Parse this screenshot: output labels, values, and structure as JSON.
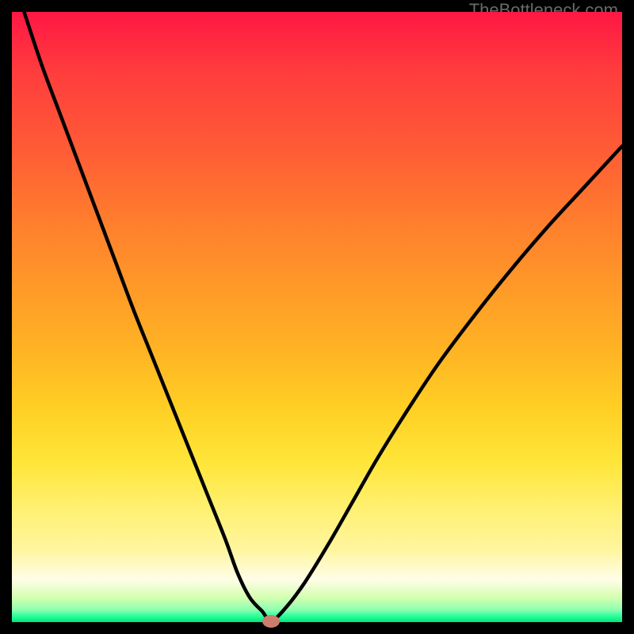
{
  "watermark": "TheBottleneck.com",
  "chart_data": {
    "type": "line",
    "title": "",
    "xlabel": "",
    "ylabel": "",
    "xlim": [
      0,
      100
    ],
    "ylim": [
      0,
      100
    ],
    "x": [
      2,
      5,
      8,
      11,
      14,
      17,
      20,
      23,
      26,
      29,
      32,
      35,
      37,
      39,
      41,
      42.5,
      45,
      48,
      52,
      56,
      60,
      65,
      70,
      76,
      82,
      88,
      94,
      100
    ],
    "y": [
      100,
      91,
      83,
      75,
      67,
      59,
      51,
      43.5,
      36,
      28.5,
      21,
      13.5,
      8,
      4,
      1.8,
      0.2,
      2.5,
      6.5,
      13,
      20,
      27,
      35,
      42.5,
      50.5,
      58,
      65,
      71.5,
      78
    ],
    "marker": {
      "x": 42.5,
      "y": 0.2
    },
    "gradient_stops": [
      {
        "pos": 0,
        "color": "#ff1744"
      },
      {
        "pos": 10,
        "color": "#ff3d3d"
      },
      {
        "pos": 22,
        "color": "#ff5a36"
      },
      {
        "pos": 33,
        "color": "#ff7a2e"
      },
      {
        "pos": 45,
        "color": "#ff9928"
      },
      {
        "pos": 55,
        "color": "#ffb224"
      },
      {
        "pos": 65,
        "color": "#ffcf24"
      },
      {
        "pos": 74,
        "color": "#ffe63a"
      },
      {
        "pos": 82,
        "color": "#fff176"
      },
      {
        "pos": 88,
        "color": "#fff59d"
      },
      {
        "pos": 93,
        "color": "#fffde7"
      },
      {
        "pos": 96,
        "color": "#d4ffb0"
      },
      {
        "pos": 98,
        "color": "#8cffb0"
      },
      {
        "pos": 99,
        "color": "#2bff9e"
      },
      {
        "pos": 100,
        "color": "#00e676"
      }
    ]
  },
  "colors": {
    "frame": "#000000",
    "curve": "#000000",
    "marker": "#cd7d6d",
    "watermark": "#6a6a6a"
  },
  "plot": {
    "svg_path": "",
    "marker_left_px": 0,
    "marker_top_px": 0
  }
}
